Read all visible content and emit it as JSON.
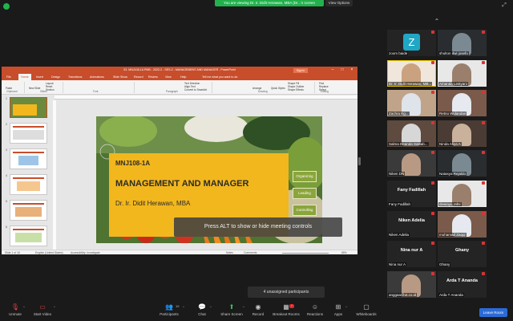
{
  "share_banner": "You are viewing Dr. Ir. Didit Herawan, MBA (Dr...'s screen",
  "view_options": "View Options",
  "ppt": {
    "title": "03. MNJ108-1A PMB - 2022-2 - SES-2 - MANAGEMENT AND MANAGER - PowerPoint",
    "signin": "Sign in",
    "tabs": [
      "File",
      "Home",
      "Insert",
      "Design",
      "Transitions",
      "Animations",
      "Slide Show",
      "Record",
      "Review",
      "View",
      "Help",
      "Tell me what you want to do"
    ],
    "ribbon": {
      "paste": "Paste",
      "new_slide": "New Slide",
      "layout": "Layout",
      "reset": "Reset",
      "section": "Section",
      "groups": [
        "Clipboard",
        "Slides",
        "Font",
        "Paragraph",
        "Drawing",
        "Editing"
      ],
      "text_dir": "Text Direction",
      "align_text": "Align Text",
      "convert_smart": "Convert to SmartArt",
      "arrange": "Arrange",
      "quick_styles": "Quick Styles",
      "shape_fill": "Shape Fill",
      "shape_outline": "Shape Outline",
      "shape_effects": "Shape Effects",
      "find": "Find",
      "replace": "Replace",
      "select": "Select"
    },
    "slide_nums": [
      "1",
      "2",
      "3",
      "4",
      "5",
      "6"
    ],
    "slide": {
      "code": "MNJ108-1A",
      "title": "MANAGEMENT AND MANAGER",
      "author": "Dr. Ir. Didit Herawan, MBA",
      "tags": [
        "Organizing",
        "Leading",
        "Controlling"
      ]
    },
    "alt_tooltip": "Press ALT to show or hide meeting controls",
    "status": {
      "slide_of": "Slide 1 of 16",
      "language": "English (United States)",
      "accessibility": "Accessibility: Investigate",
      "notes": "Notes",
      "comments": "Comments",
      "zoom": "88%"
    }
  },
  "gallery": [
    {
      "name": "zoom baide",
      "initial": "Z",
      "kind": "avatar"
    },
    {
      "name": "shulton dwi josefo",
      "kind": "video"
    },
    {
      "name": "Dr. Ir. Didit Herawan, MB...",
      "kind": "video",
      "highlight": true
    },
    {
      "name": "Amanda Lestyani",
      "kind": "video"
    },
    {
      "name": "Zachra Eg...",
      "kind": "video"
    },
    {
      "name": "Retno Wulandari",
      "kind": "video"
    },
    {
      "name": "Salma Deanda Salsab...",
      "kind": "video"
    },
    {
      "name": "Ninda Afiya A",
      "kind": "video"
    },
    {
      "name": "Niken DN",
      "kind": "video"
    },
    {
      "name": "Natasya Rejaldo",
      "kind": "video"
    },
    {
      "name": "Fany Fadillah",
      "big": "Fany Fadillah",
      "kind": "name"
    },
    {
      "name": "dewiayu rafni",
      "kind": "video"
    },
    {
      "name": "Niken Adelia",
      "big": "Niken Adelia",
      "kind": "name"
    },
    {
      "name": "muhamad Zaqqi",
      "kind": "video"
    },
    {
      "name": "Nina nur A",
      "big": "Nina nur A",
      "kind": "name"
    },
    {
      "name": "Ghany",
      "big": "Ghany",
      "kind": "name"
    },
    {
      "name": "anggaa@ut.co.id",
      "kind": "video"
    },
    {
      "name": "Arda T Ananda",
      "big": "Arda T Ananda",
      "kind": "name"
    }
  ],
  "unassigned": "4 unassigned participants",
  "toolbar": {
    "unmute": "Unmute",
    "start_video": "Start Video",
    "participants": "Participants",
    "participants_count": "19",
    "chat": "Chat",
    "share_screen": "Share Screen",
    "record": "Record",
    "breakout": "Breakout Rooms",
    "reactions": "Reactions",
    "apps": "Apps",
    "whiteboards": "Whiteboards",
    "leave": "Leave Room"
  },
  "colors": {
    "zoom_green": "#23b14d",
    "ppt_orange": "#c84d2b",
    "slide_yellow": "#f2b71d",
    "leave_blue": "#2c6bd6"
  }
}
